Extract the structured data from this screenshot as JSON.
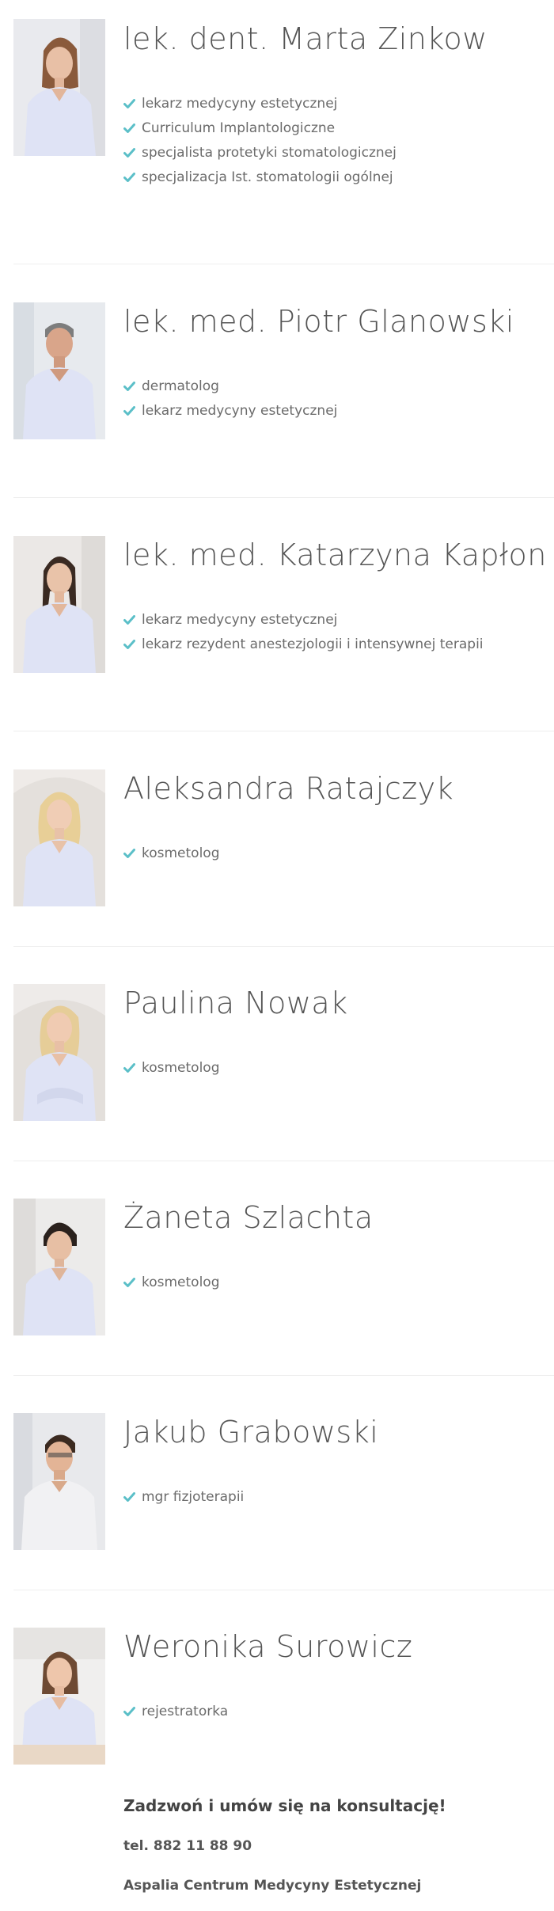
{
  "team": [
    {
      "name": "lek. dent. Marta Zinkow",
      "qualifications": [
        "lekarz medycyny estetycznej",
        "Curriculum Implantologiczne",
        "specjalista protetyki stomatologicznej",
        "specjalizacja Ist. stomatologii ogólnej"
      ]
    },
    {
      "name": "lek. med. Piotr Glanowski",
      "qualifications": [
        "dermatolog",
        "lekarz medycyny estetycznej"
      ]
    },
    {
      "name": "lek. med. Katarzyna Kapłon",
      "qualifications": [
        "lekarz medycyny estetycznej",
        "lekarz rezydent anestezjologii i intensywnej terapii"
      ]
    },
    {
      "name": "Aleksandra Ratajczyk",
      "qualifications": [
        "kosmetolog"
      ]
    },
    {
      "name": "Paulina Nowak",
      "qualifications": [
        "kosmetolog"
      ]
    },
    {
      "name": "Żaneta Szlachta",
      "qualifications": [
        "kosmetolog"
      ]
    },
    {
      "name": "Jakub Grabowski",
      "qualifications": [
        "mgr fizjoterapii"
      ]
    },
    {
      "name": "Weronika Surowicz",
      "qualifications": [
        "rejestratorka"
      ]
    }
  ],
  "contact": {
    "heading": "Zadzwoń i umów się na konsultację!",
    "phone": "tel. 882 11 88 90",
    "company": "Aspalia Centrum Medycyny Estetycznej"
  },
  "colors": {
    "check": "#5bbfc8",
    "divider": "#eeeeee",
    "uniform": "#dfe3f5"
  }
}
